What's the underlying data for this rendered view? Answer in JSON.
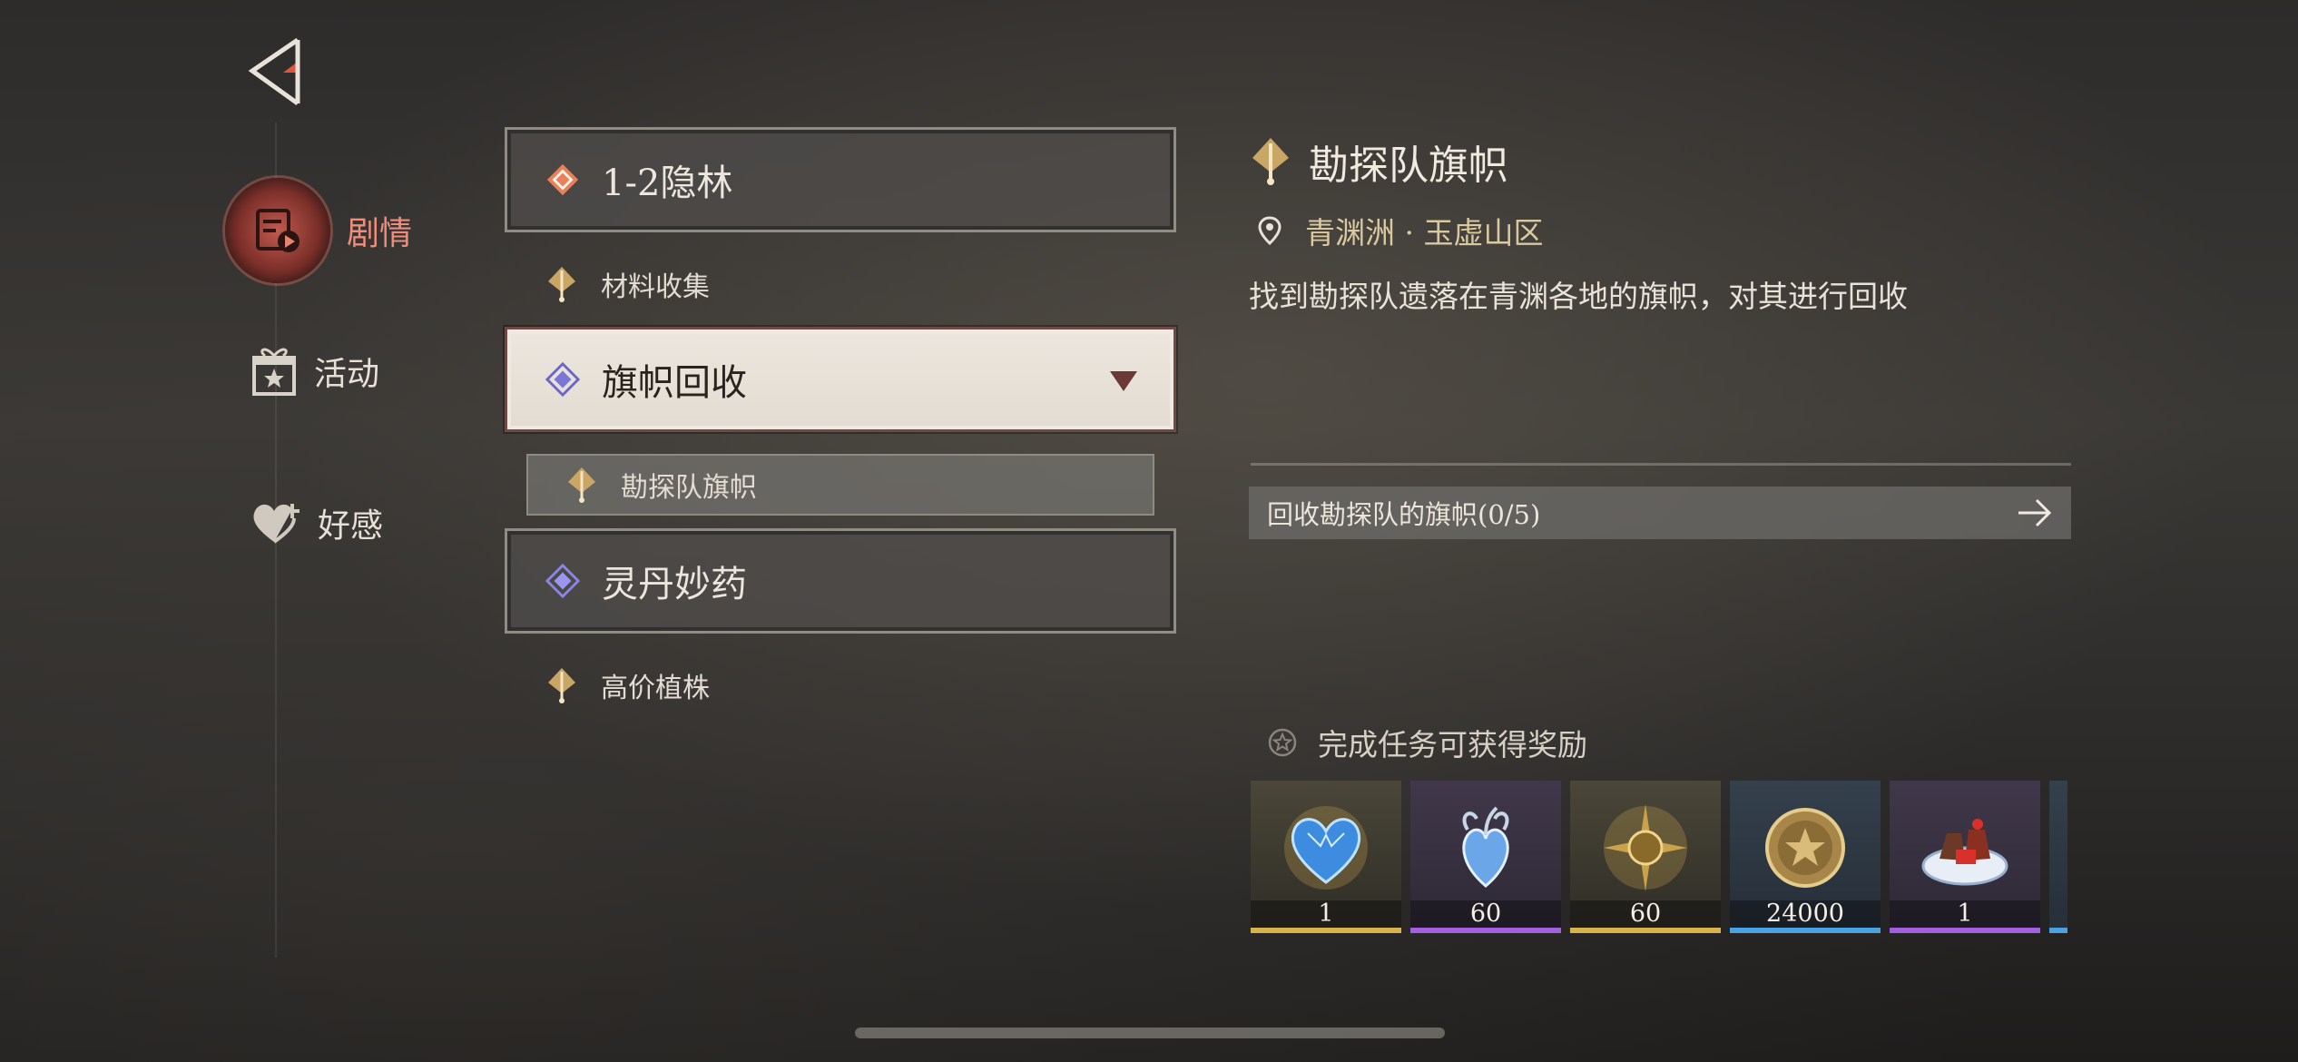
{
  "nav": {
    "story": "剧情",
    "activity": "活动",
    "favor": "好感"
  },
  "quests": {
    "group1": {
      "title": "1-2隐林",
      "sub": "材料收集"
    },
    "group2": {
      "title": "旗帜回收",
      "sub": "勘探队旗帜"
    },
    "group3": {
      "title": "灵丹妙药",
      "sub": "高价植株"
    }
  },
  "detail": {
    "title": "勘探队旗帜",
    "location": "青渊洲 · 玉虚山区",
    "description": "找到勘探队遗落在青渊各地的旗帜，对其进行回收",
    "objective": "回收勘探队的旗帜(0/5)",
    "rewards_title": "完成任务可获得奖励",
    "rewards": [
      {
        "name": "blue-heart-gem",
        "count": "1",
        "rarity_color": "#d8b24a"
      },
      {
        "name": "crystal-heart",
        "count": "60",
        "rarity_color": "#a45ee0"
      },
      {
        "name": "gold-star-orb",
        "count": "60",
        "rarity_color": "#d8b24a"
      },
      {
        "name": "gold-coin",
        "count": "24000",
        "rarity_color": "#4aa3e0"
      },
      {
        "name": "cake-dish",
        "count": "1",
        "rarity_color": "#a45ee0"
      }
    ]
  },
  "colors": {
    "accent": "#f08c7c",
    "active_card": "#ece6de",
    "gold": "#d8b24a",
    "purple": "#a45ee0",
    "blue": "#4aa3e0"
  }
}
